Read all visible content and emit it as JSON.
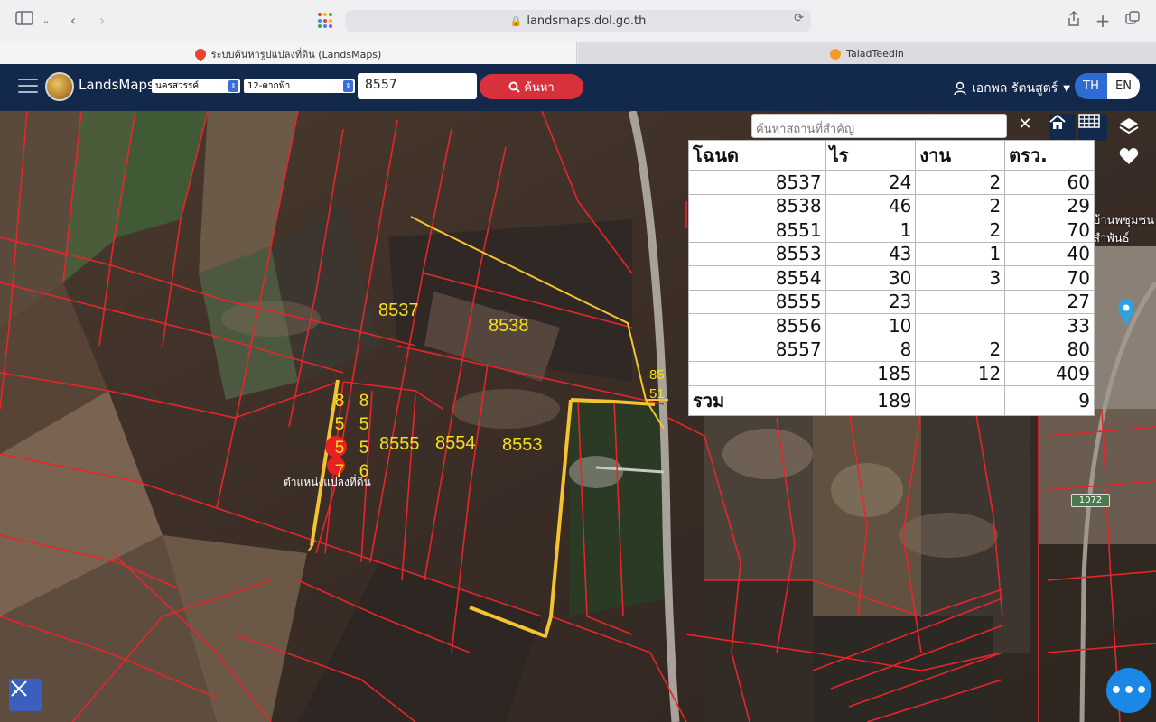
{
  "browser": {
    "url": "landsmaps.dol.go.th",
    "tabs": [
      {
        "title": "ระบบค้นหารูปแปลงที่ดิน (LandsMaps)",
        "active": true
      },
      {
        "title": "TaladTeedin",
        "active": false
      }
    ]
  },
  "header": {
    "app_name": "LandsMaps",
    "province": "นครสวรรค์",
    "district": "12-ตากฟ้า",
    "parcel_number": "8557",
    "search_label": "ค้นหา",
    "user_name": "เอกพล รัตนสูตร์",
    "lang_th": "TH",
    "lang_en": "EN"
  },
  "map": {
    "place_search_placeholder": "ค้นหาสถานที่สำคัญ",
    "position_label": "ตำแหน่งแปลงที่ดิน",
    "road_number": "1072",
    "poi_text": [
      "บ้านพชุมชน",
      "สำพันธ์"
    ],
    "parcel_labels": {
      "p8537": "8537",
      "p8538": "8538",
      "p8555": "8555",
      "p8554": "8554",
      "p8553": "8553",
      "p8551_top": "85",
      "p8551_bottom": "51"
    },
    "vertical_labels": {
      "p8557": [
        "8",
        "5",
        "5",
        "7"
      ],
      "p8556": [
        "8",
        "5",
        "5",
        "6"
      ]
    }
  },
  "parcel_table": {
    "headers": [
      "โฉนด",
      "ไร",
      "งาน",
      "ตรว."
    ],
    "rows": [
      [
        "8537",
        "24",
        "2",
        "60"
      ],
      [
        "8538",
        "46",
        "2",
        "29"
      ],
      [
        "8551",
        "1",
        "2",
        "70"
      ],
      [
        "8553",
        "43",
        "1",
        "40"
      ],
      [
        "8554",
        "30",
        "3",
        "70"
      ],
      [
        "8555",
        "23",
        "",
        "27"
      ],
      [
        "8556",
        "10",
        "",
        "33"
      ],
      [
        "8557",
        "8",
        "2",
        "80"
      ],
      [
        "",
        "185",
        "12",
        "409"
      ]
    ],
    "total": [
      "รวม",
      "189",
      "",
      "9"
    ]
  },
  "colors": {
    "header_bg": "#13294b",
    "search_btn": "#d9313c",
    "parcel_line": "#e8252a",
    "highlight": "#f5c232",
    "label_yellow": "#f5e11b"
  }
}
